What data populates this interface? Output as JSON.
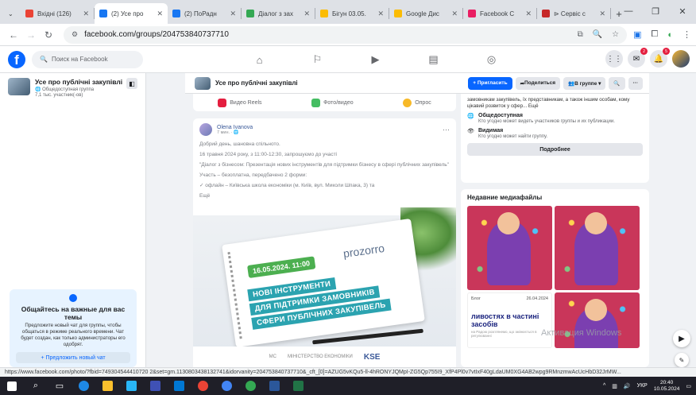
{
  "browser": {
    "tabs": [
      {
        "title": "Вхідні (126)",
        "color": "#ea4335",
        "active": false
      },
      {
        "title": "(2) Усе про",
        "color": "#1877f2",
        "active": true
      },
      {
        "title": "(2) ПоРадн",
        "color": "#1877f2",
        "active": false
      },
      {
        "title": "Діалог з зах",
        "color": "#34a853",
        "active": false
      },
      {
        "title": "Бігун 03.05.",
        "color": "#fbbc04",
        "active": false
      },
      {
        "title": "Google Дис",
        "color": "#fbbc04",
        "active": false
      },
      {
        "title": "Facebook C",
        "color": "#e91e63",
        "active": false
      },
      {
        "title": "⊳ Сервіс с",
        "color": "#c62828",
        "active": false
      }
    ],
    "url": "facebook.com/groups/204753840737710",
    "status_url": "https://www.facebook.com/photo/?fbid=749304544410720 2&set=gm.1130803438132741&idorvanity=204753840737710&_cft_[0]=AZUG5vKQu5-ll-4hRONYJQMpI-ZG5Qp755I9_XfP4Pl0v7vtIxF40gLdaUM0XG4AB2wpg9RMnzmwAcUcHbD32JrMW..."
  },
  "facebook": {
    "search_placeholder": "Поиск на Facebook",
    "notif_badge": "5",
    "msg_badge": "2"
  },
  "left": {
    "group_name": "Усе про публічні закупівлі",
    "group_privacy": "Общедоступная группа",
    "group_members": "7,1 тыс. участник(-ов)",
    "chat_title": "Общайтесь на важные для вас темы",
    "chat_text": "Предложите новый чат для группы, чтобы общаться в режиме реального времени. Чат будет создан, как только администраторы его одобрят.",
    "chat_button": "+ Предложить новый чат"
  },
  "groupbar": {
    "name": "Усе про публічні закупівлі",
    "invite": "+ Пригласить",
    "share": "Поделиться",
    "in_group": "В группе ▾",
    "search": "🔍",
    "more": "···"
  },
  "composer": {
    "reels": "Видео Reels",
    "photo": "Фото/видео",
    "poll": "Опрос"
  },
  "post": {
    "author": "Olena Ivanova",
    "time": "7 мин. ·",
    "more": "···",
    "lines": [
      "Добрий день, шановна спільното.",
      "16 травня 2024 року, з 11:00-12:30, запрошуємо до участі",
      "\"Діалог з бізнесом: Презентація нових інструментів для підтримки бізнесу в сфері публічних закупівель\"",
      "Участь – безоплатна, передбачено 2 форми:",
      "✓ офлайн – Київська школа економіки (м. Київ, вул. Миколи Шпака, 3) та",
      "Ещё"
    ],
    "image": {
      "date": "16.05.2024. 11:00",
      "logo": "prozorro",
      "headline": [
        "НОВІ ІНСТРУМЕНТИ",
        "ДЛЯ ПІДТРИМКИ ЗАМОВНИКІВ",
        "СФЕРИ ПУБЛІЧНИХ ЗАКУПІВЕЛЬ"
      ],
      "logos": [
        "MC",
        "МІНІСТЕРСТВО ЕКОНОМІКИ",
        "KSE"
      ]
    }
  },
  "right": {
    "about_intro": "замовникам закупівель, їх представникам, а також іншим особам, кому цікавий розвиток у сфер... Ещё",
    "public_title": "Общедоступная",
    "public_desc": "Кто угодно может видеть участников группы и их публикации.",
    "visible_title": "Видимая",
    "visible_desc": "Кто угодно может найти группу.",
    "more_btn": "Подробнее",
    "media_title": "Недавние медиафайлы",
    "doc_label": "Блог",
    "doc_date": "26.04.2024",
    "doc_title": "ливостях в частині засобів",
    "doc_sub": "на Радою розглянемо, що змінюється в регулюванні"
  },
  "watermark": "Активация Windows",
  "taskbar": {
    "lang": "УКР",
    "time": "20:40",
    "date": "10.05.2024"
  }
}
